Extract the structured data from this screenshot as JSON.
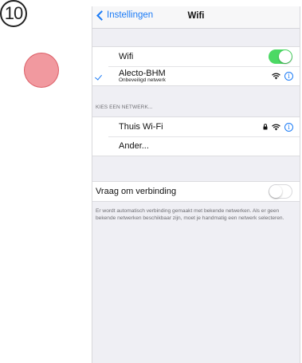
{
  "step": {
    "number": "10"
  },
  "navbar": {
    "back_label": "Instellingen",
    "title": "Wifi"
  },
  "wifi_toggle": {
    "label": "Wifi",
    "state": "on"
  },
  "connected_network": {
    "name": "Alecto-BHM",
    "subtitle": "Onbeveiligd netwerk",
    "selected": true
  },
  "choose_network": {
    "header": "KIES EEN NETWERK...",
    "networks": [
      {
        "name": "Thuis Wi-Fi",
        "locked": true
      },
      {
        "name": "Ander..."
      }
    ]
  },
  "ask_to_join": {
    "label": "Vraag om verbinding",
    "state": "off",
    "description": "Er wordt automatisch verbinding gemaakt met bekende netwerken. Als er geen bekende netwerken beschikbaar zijn, moet je handmatig een netwerk selecteren."
  },
  "colors": {
    "accent": "#1b7bf6",
    "toggle_on": "#4cd964",
    "background": "#efeff4",
    "tap_indicator": "#e64650"
  },
  "icons": [
    "chevron-left-icon",
    "checkmark-icon",
    "wifi-icon",
    "lock-icon",
    "info-icon"
  ]
}
